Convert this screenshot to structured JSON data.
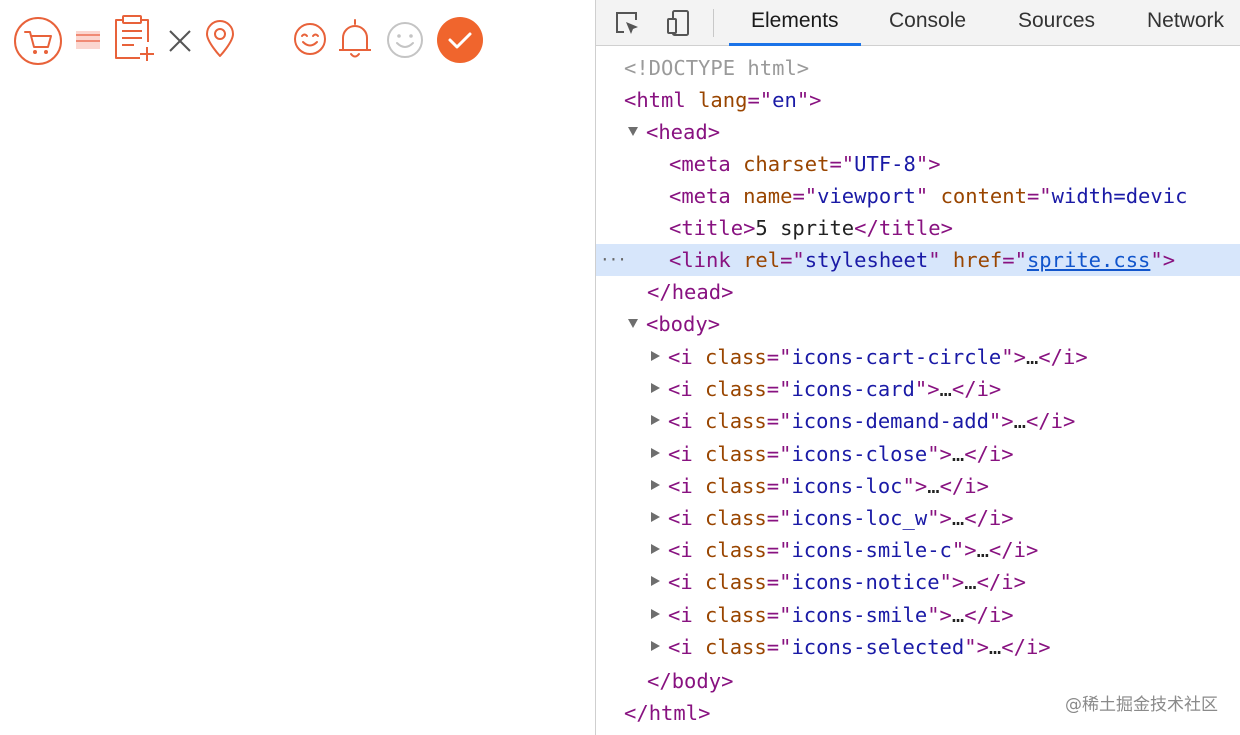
{
  "page": {
    "icons": [
      {
        "name": "cart-circle-icon",
        "class": "icons-cart-circle"
      },
      {
        "name": "card-icon",
        "class": "icons-card"
      },
      {
        "name": "demand-add-icon",
        "class": "icons-demand-add"
      },
      {
        "name": "close-icon",
        "class": "icons-close"
      },
      {
        "name": "location-icon",
        "class": "icons-loc"
      },
      {
        "name": "location-white-icon",
        "class": "icons-loc_w"
      },
      {
        "name": "smile-colored-icon",
        "class": "icons-smile-c"
      },
      {
        "name": "notice-bell-icon",
        "class": "icons-notice"
      },
      {
        "name": "smile-icon",
        "class": "icons-smile"
      },
      {
        "name": "selected-check-icon",
        "class": "icons-selected"
      }
    ],
    "colors": {
      "accent": "#e8623a",
      "accent_fill": "#f0652d",
      "gray_icon": "#c8c8c8",
      "dark_icon": "#555555",
      "card_stripe": "#f5b3a8"
    }
  },
  "devtools": {
    "toolbar": {
      "inspect_icon": "element-picker-icon",
      "device_icon": "device-toolbar-icon"
    },
    "tabs": [
      {
        "label": "Elements",
        "active": true
      },
      {
        "label": "Console",
        "active": false
      },
      {
        "label": "Sources",
        "active": false
      },
      {
        "label": "Network",
        "active": false
      }
    ],
    "dom": {
      "doctype": "<!DOCTYPE html>",
      "html_open": {
        "tag": "html",
        "attr": "lang",
        "value": "en"
      },
      "head_tag": "head",
      "meta_charset": {
        "tag": "meta",
        "attr": "charset",
        "value": "UTF-8"
      },
      "meta_viewport": {
        "tag": "meta",
        "attr": "name",
        "value": "viewport",
        "attr2": "content",
        "value2": "width=devic"
      },
      "title": {
        "tag": "title",
        "text": "5 sprite"
      },
      "link": {
        "tag": "link",
        "attr": "rel",
        "value": "stylesheet",
        "attr2": "href",
        "value2": "sprite.css"
      },
      "head_close": "head",
      "body_tag": "body",
      "body_children": [
        "icons-cart-circle",
        "icons-card",
        "icons-demand-add",
        "icons-close",
        "icons-loc",
        "icons-loc_w",
        "icons-smile-c",
        "icons-notice",
        "icons-smile",
        "icons-selected"
      ],
      "body_close": "body",
      "html_close": "html",
      "ellipsis": "…",
      "selected_dots": "···"
    },
    "watermark": "@稀土掘金技术社区"
  }
}
